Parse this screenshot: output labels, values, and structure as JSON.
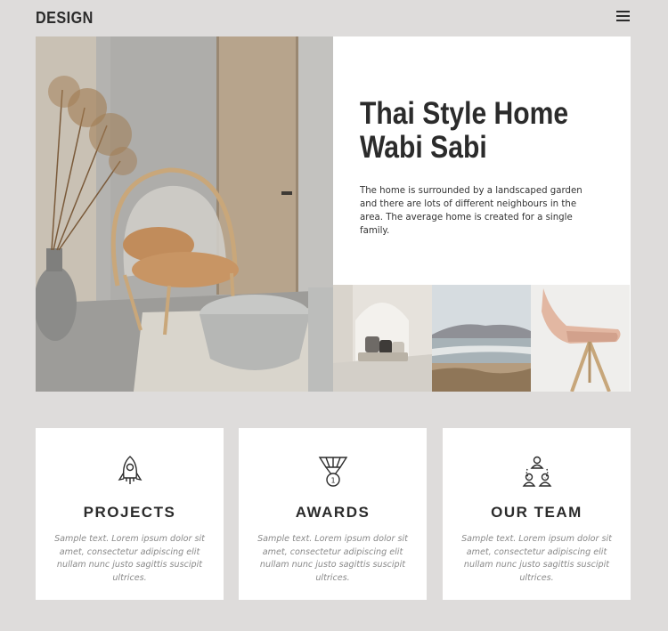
{
  "header": {
    "logo": "DESIGN",
    "menu_icon": "hamburger-menu-icon"
  },
  "hero": {
    "title_line1": "Thai Style Home",
    "title_line2": "Wabi Sabi",
    "description": "The home is surrounded by a landscaped garden and there are lots of different neighbours in the area.  The average home is created for a single family.",
    "main_image": "interior-chair-photo",
    "thumbnails": [
      "alcove-cushions-photo",
      "seaside-landscape-photo",
      "wooden-chair-photo"
    ]
  },
  "features": [
    {
      "icon": "rocket-icon",
      "title": "PROJECTS",
      "text": "Sample text. Lorem ipsum dolor sit amet, consectetur adipiscing elit nullam nunc justo sagittis suscipit ultrices."
    },
    {
      "icon": "medal-icon",
      "title": "AWARDS",
      "text": "Sample text. Lorem ipsum dolor sit amet, consectetur adipiscing elit nullam nunc justo sagittis suscipit ultrices."
    },
    {
      "icon": "team-icon",
      "title": "OUR TEAM",
      "text": "Sample text. Lorem ipsum dolor sit amet, consectetur adipiscing elit nullam nunc justo sagittis suscipit ultrices."
    }
  ],
  "colors": {
    "page_background": "#dedcdb",
    "card_background": "#ffffff",
    "heading": "#2b2b2b",
    "muted_text": "#8a8a8a"
  }
}
